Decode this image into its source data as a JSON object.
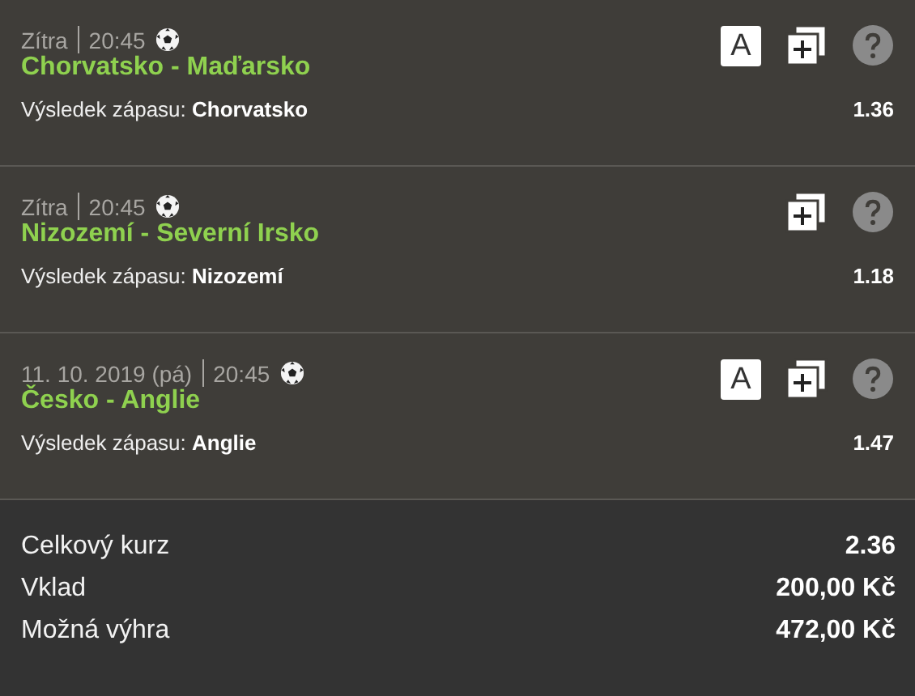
{
  "bets": [
    {
      "date": "Zítra",
      "time": "20:45",
      "badge": "A",
      "match": "Chorvatsko - Maďarsko",
      "market": "Výsledek zápasu:",
      "pick": "Chorvatsko",
      "odds": "1.36"
    },
    {
      "date": "Zítra",
      "time": "20:45",
      "match": "Nizozemí - Severní Irsko",
      "market": "Výsledek zápasu:",
      "pick": "Nizozemí",
      "odds": "1.18"
    },
    {
      "date": "11. 10. 2019 (pá)",
      "time": "20:45",
      "badge": "A",
      "match": "Česko - Anglie",
      "market": "Výsledek zápasu:",
      "pick": "Anglie",
      "odds": "1.47"
    }
  ],
  "summary": [
    {
      "label": "Celkový kurz",
      "value": "2.36"
    },
    {
      "label": "Vklad",
      "value": "200,00 Kč"
    },
    {
      "label": "Možná výhra",
      "value": "472,00 Kč"
    }
  ]
}
